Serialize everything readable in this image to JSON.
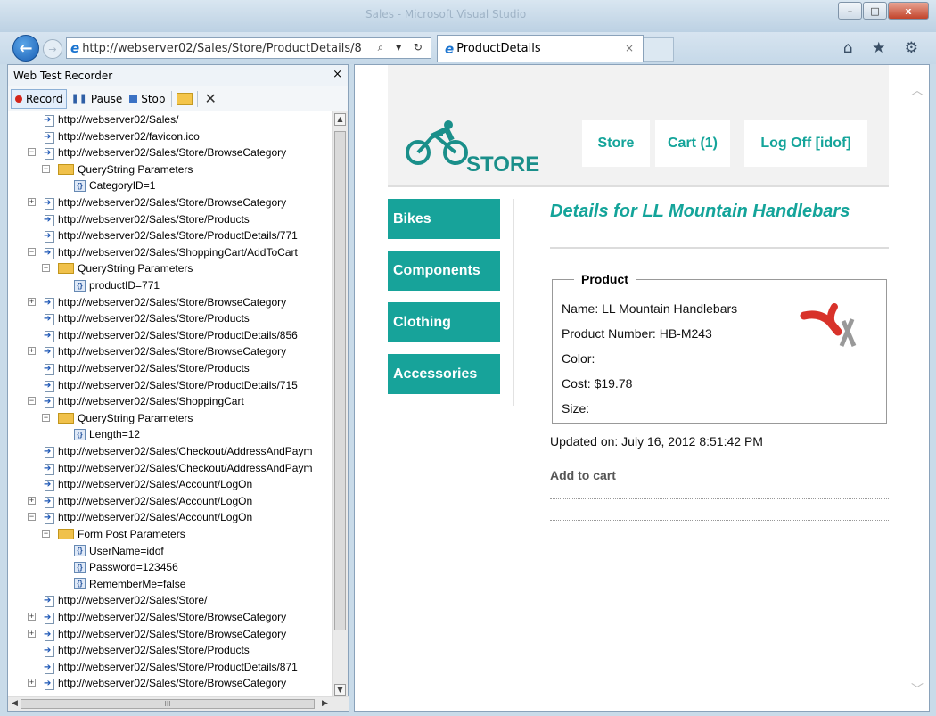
{
  "window": {
    "title": "Sales - Microsoft Visual Studio",
    "minimize": "–",
    "maximize": "□",
    "close": "x"
  },
  "browser": {
    "back": "←",
    "forward": "→",
    "url": "http://webserver02/Sales/Store/ProductDetails/8",
    "url_buttons": "⌕ ▾ ↻",
    "tab_title": "ProductDetails",
    "tab_close": "×",
    "tool_icons": "⌂ ★ ⚙"
  },
  "recorder": {
    "title": "Web Test Recorder",
    "close": "×",
    "toolbar": {
      "record": "Record",
      "pause": "Pause",
      "stop": "Stop",
      "delete": "✕"
    },
    "tree": [
      {
        "level": 0,
        "type": "req",
        "text": "http://webserver02/Sales/"
      },
      {
        "level": 0,
        "type": "req",
        "text": "http://webserver02/favicon.ico"
      },
      {
        "level": 0,
        "type": "req",
        "text": "http://webserver02/Sales/Store/BrowseCategory",
        "exp": "-"
      },
      {
        "level": 1,
        "type": "folder",
        "text": "QueryString Parameters",
        "exp": "-"
      },
      {
        "level": 2,
        "type": "param",
        "text": "CategoryID=1"
      },
      {
        "level": 0,
        "type": "req",
        "text": "http://webserver02/Sales/Store/BrowseCategory",
        "exp": "+"
      },
      {
        "level": 0,
        "type": "req",
        "text": "http://webserver02/Sales/Store/Products"
      },
      {
        "level": 0,
        "type": "req",
        "text": "http://webserver02/Sales/Store/ProductDetails/771"
      },
      {
        "level": 0,
        "type": "req",
        "text": "http://webserver02/Sales/ShoppingCart/AddToCart",
        "exp": "-"
      },
      {
        "level": 1,
        "type": "folder",
        "text": "QueryString Parameters",
        "exp": "-"
      },
      {
        "level": 2,
        "type": "param",
        "text": "productID=771"
      },
      {
        "level": 0,
        "type": "req",
        "text": "http://webserver02/Sales/Store/BrowseCategory",
        "exp": "+"
      },
      {
        "level": 0,
        "type": "req",
        "text": "http://webserver02/Sales/Store/Products"
      },
      {
        "level": 0,
        "type": "req",
        "text": "http://webserver02/Sales/Store/ProductDetails/856"
      },
      {
        "level": 0,
        "type": "req",
        "text": "http://webserver02/Sales/Store/BrowseCategory",
        "exp": "+"
      },
      {
        "level": 0,
        "type": "req",
        "text": "http://webserver02/Sales/Store/Products"
      },
      {
        "level": 0,
        "type": "req",
        "text": "http://webserver02/Sales/Store/ProductDetails/715"
      },
      {
        "level": 0,
        "type": "req",
        "text": "http://webserver02/Sales/ShoppingCart",
        "exp": "-"
      },
      {
        "level": 1,
        "type": "folder",
        "text": "QueryString Parameters",
        "exp": "-"
      },
      {
        "level": 2,
        "type": "param",
        "text": "Length=12"
      },
      {
        "level": 0,
        "type": "req",
        "text": "http://webserver02/Sales/Checkout/AddressAndPaym"
      },
      {
        "level": 0,
        "type": "req",
        "text": "http://webserver02/Sales/Checkout/AddressAndPaym"
      },
      {
        "level": 0,
        "type": "req",
        "text": "http://webserver02/Sales/Account/LogOn"
      },
      {
        "level": 0,
        "type": "req",
        "text": "http://webserver02/Sales/Account/LogOn",
        "exp": "+"
      },
      {
        "level": 0,
        "type": "req",
        "text": "http://webserver02/Sales/Account/LogOn",
        "exp": "-"
      },
      {
        "level": 1,
        "type": "folder",
        "text": "Form Post Parameters",
        "exp": "-"
      },
      {
        "level": 2,
        "type": "param",
        "text": "UserName=idof"
      },
      {
        "level": 2,
        "type": "param",
        "text": "Password=123456"
      },
      {
        "level": 2,
        "type": "param",
        "text": "RememberMe=false"
      },
      {
        "level": 0,
        "type": "req",
        "text": "http://webserver02/Sales/Store/"
      },
      {
        "level": 0,
        "type": "req",
        "text": "http://webserver02/Sales/Store/BrowseCategory",
        "exp": "+"
      },
      {
        "level": 0,
        "type": "req",
        "text": "http://webserver02/Sales/Store/BrowseCategory",
        "exp": "+"
      },
      {
        "level": 0,
        "type": "req",
        "text": "http://webserver02/Sales/Store/Products"
      },
      {
        "level": 0,
        "type": "req",
        "text": "http://webserver02/Sales/Store/ProductDetails/871"
      },
      {
        "level": 0,
        "type": "req",
        "text": "http://webserver02/Sales/Store/BrowseCategory",
        "exp": "+"
      }
    ],
    "hscroll_grip": "III"
  },
  "page": {
    "logo_text": "STORE",
    "nav": {
      "store": "Store",
      "cart": "Cart (1)",
      "logoff": "Log Off [idof]"
    },
    "categories": [
      "Bikes",
      "Components",
      "Clothing",
      "Accessories"
    ],
    "details_title": "Details for LL Mountain Handlebars",
    "product_legend": "Product",
    "product": {
      "name": "Name: LL Mountain Handlebars",
      "number": "Product Number: HB-M243",
      "color": "Color:",
      "cost": "Cost: $19.78",
      "size": "Size:"
    },
    "updated": "Updated on: July 16, 2012 8:51:42 PM",
    "add_to_cart": "Add to cart"
  },
  "colors": {
    "accent": "#17a39a",
    "record_red": "#d4261c"
  }
}
